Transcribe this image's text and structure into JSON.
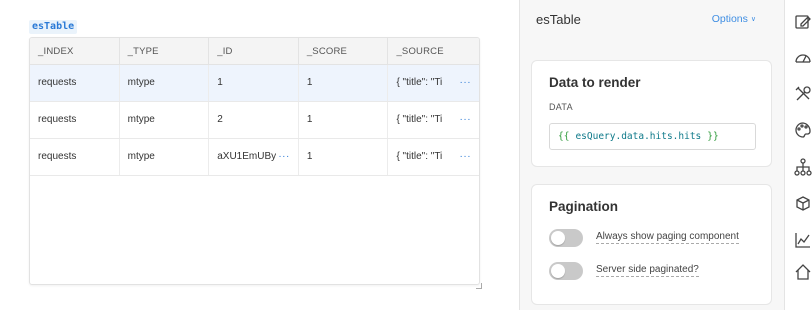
{
  "canvas": {
    "component_tag": "esTable",
    "table": {
      "headers": [
        "_INDEX",
        "_TYPE",
        "_ID",
        "_SCORE",
        "_SOURCE"
      ],
      "rows": [
        {
          "index": "requests",
          "type": "mtype",
          "id": "1",
          "score": "1",
          "source": "{ \"title\": \"Ti"
        },
        {
          "index": "requests",
          "type": "mtype",
          "id": "2",
          "score": "1",
          "source": "{ \"title\": \"Ti"
        },
        {
          "index": "requests",
          "type": "mtype",
          "id": "aXU1EmUBy",
          "score": "1",
          "source": "{ \"title\": \"Ti"
        }
      ],
      "more_glyph": "···",
      "selected_row": 0
    }
  },
  "inspector": {
    "title": "esTable",
    "options_label": "Options",
    "options_chevron": "∨",
    "data_card": {
      "title": "Data to render",
      "field_label": "DATA",
      "open_brace": "{{",
      "expression": "esQuery.data.hits.hits",
      "close_brace": "}}"
    },
    "pagination_card": {
      "title": "Pagination",
      "toggles": [
        {
          "label": "Always show paging component",
          "on": false
        },
        {
          "label": "Server side paginated?",
          "on": false
        }
      ]
    }
  },
  "rail": {
    "icons": [
      "edit-icon",
      "gauge-icon",
      "tools-icon",
      "palette-icon",
      "hierarchy-icon",
      "cube-icon",
      "line-chart-icon",
      "home-icon"
    ]
  },
  "colors": {
    "accent": "#3f8ee3",
    "code_green": "#2f9b3b",
    "selected_row": "#eef4fd",
    "toggle_off": "#c9c9c9"
  }
}
